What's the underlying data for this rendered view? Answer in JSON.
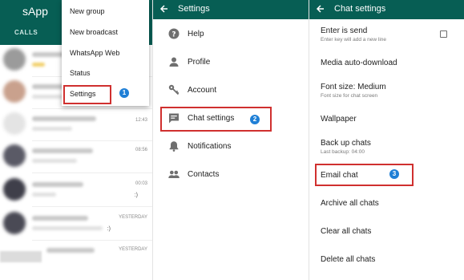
{
  "panel1": {
    "app_title": "sApp",
    "tab_label": "CALLS",
    "chats": [
      {
        "time": "",
        "preview": ""
      },
      {
        "time": "",
        "preview": ""
      },
      {
        "time": "",
        "preview": ""
      },
      {
        "time": "12:43",
        "preview": ""
      },
      {
        "time": "08:56",
        "preview": ""
      },
      {
        "time": "00:03",
        "preview": ":)"
      },
      {
        "time": "YESTERDAY",
        "preview": ":)"
      },
      {
        "time": "YESTERDAY",
        "preview": ""
      }
    ],
    "menu": {
      "items": [
        "New group",
        "New broadcast",
        "WhatsApp Web",
        "Status",
        "Settings"
      ],
      "highlighted": "Settings",
      "step_badge": "1"
    }
  },
  "panel2": {
    "title": "Settings",
    "items": [
      {
        "label": "Help",
        "icon": "help-icon"
      },
      {
        "label": "Profile",
        "icon": "person-icon"
      },
      {
        "label": "Account",
        "icon": "key-icon"
      },
      {
        "label": "Chat settings",
        "icon": "chat-icon"
      },
      {
        "label": "Notifications",
        "icon": "bell-icon"
      },
      {
        "label": "Contacts",
        "icon": "people-icon"
      }
    ],
    "highlighted": "Chat settings",
    "step_badge": "2"
  },
  "panel3": {
    "title": "Chat settings",
    "items": [
      {
        "title": "Enter is send",
        "subtitle": "Enter key will add a new line",
        "checkbox": true,
        "checked": false
      },
      {
        "title": "Media auto-download",
        "subtitle": ""
      },
      {
        "title": "Font size: Medium",
        "subtitle": "Font size for chat screen"
      },
      {
        "title": "Wallpaper",
        "subtitle": ""
      },
      {
        "title": "Back up chats",
        "subtitle": "Last backup: 04:00"
      },
      {
        "title": "Email chat",
        "subtitle": ""
      },
      {
        "title": "Archive all chats",
        "subtitle": ""
      },
      {
        "title": "Clear all chats",
        "subtitle": ""
      },
      {
        "title": "Delete all chats",
        "subtitle": ""
      }
    ],
    "highlighted": "Email chat",
    "step_badge": "3"
  },
  "colors": {
    "toolbar": "#075e54",
    "highlight_box": "#d0302f",
    "step_badge": "#1f7fd6",
    "icon": "#6f6f6f"
  }
}
